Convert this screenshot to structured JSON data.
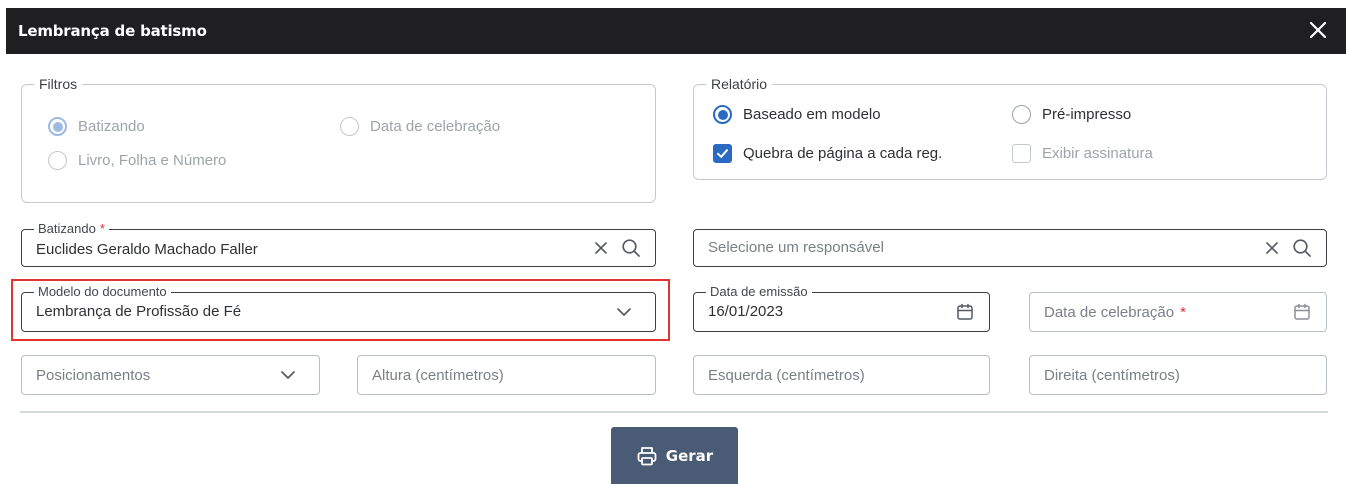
{
  "dialog": {
    "title": "Lembrança de batismo"
  },
  "filtros": {
    "legend": "Filtros",
    "options": [
      {
        "label": "Batizando",
        "checked": true
      },
      {
        "label": "Data de celebração",
        "checked": false
      },
      {
        "label": "Livro, Folha e Número",
        "checked": false
      }
    ]
  },
  "relatorio": {
    "legend": "Relatório",
    "radio_modelo": "Baseado em modelo",
    "radio_pre": "Pré-impresso",
    "check_quebra": "Quebra de página a cada reg.",
    "check_assinatura": "Exibir assinatura"
  },
  "batizando": {
    "label": "Batizando",
    "required": "*",
    "value": "Euclides Geraldo Machado Faller"
  },
  "responsavel": {
    "placeholder": "Selecione um responsável"
  },
  "modelo": {
    "label": "Modelo do documento",
    "value": "Lembrança de Profissão de Fé"
  },
  "emissao": {
    "label": "Data de emissão",
    "value": "16/01/2023"
  },
  "celebracao": {
    "placeholder": "Data de celebração",
    "required": "*"
  },
  "posicionamentos": {
    "placeholder": "Posicionamentos"
  },
  "altura": {
    "placeholder": "Altura (centímetros)"
  },
  "esquerda": {
    "placeholder": "Esquerda (centímetros)"
  },
  "direita": {
    "placeholder": "Direita (centímetros)"
  },
  "actions": {
    "gerar": "Gerar"
  },
  "colors": {
    "accent": "#2a6ac3",
    "header_bg": "#1f1f21",
    "button_bg": "#4a5b75",
    "required": "#e0303d",
    "highlight": "#e3342f"
  }
}
